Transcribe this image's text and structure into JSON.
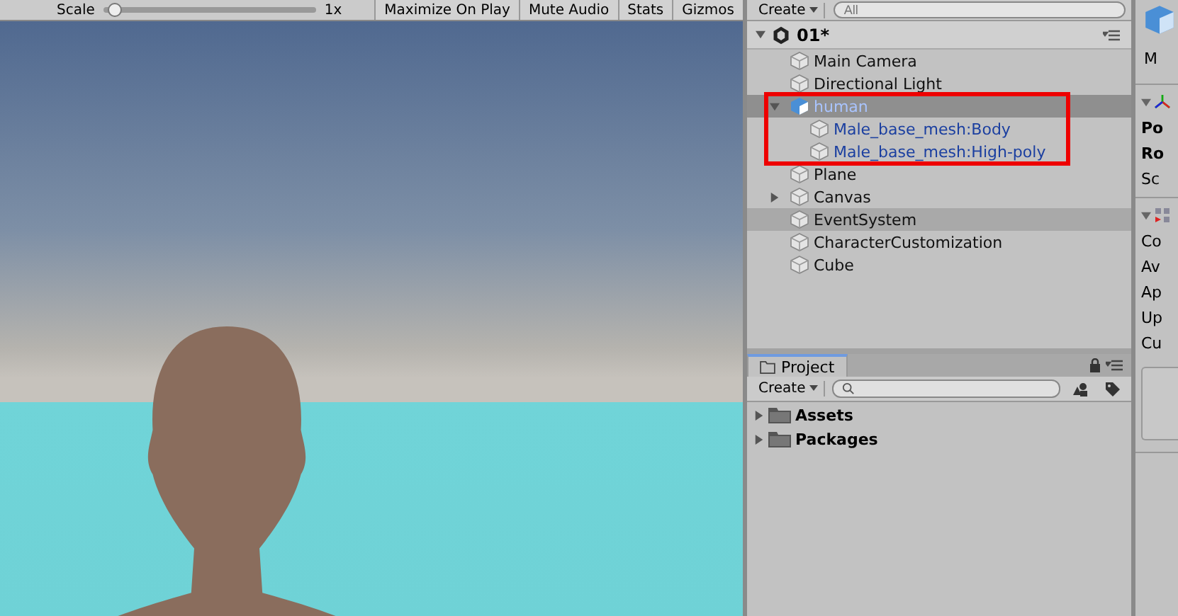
{
  "game_toolbar": {
    "scale_label": "Scale",
    "scale_slider": {
      "level": 0.02
    },
    "scale_value": "1x",
    "buttons": [
      {
        "label": "Maximize On Play",
        "on": false
      },
      {
        "label": "Mute Audio",
        "on": false
      },
      {
        "label": "Stats",
        "on": false
      },
      {
        "label": "Gizmos",
        "on": false
      }
    ]
  },
  "hierarchy": {
    "create_button": "Create",
    "search": {
      "placeholder": "All"
    },
    "scene": {
      "name": "01*",
      "expanded": true
    },
    "items": [
      {
        "name": "Main Camera",
        "kind": "object",
        "selected": false,
        "highlighted": false
      },
      {
        "name": "Directional Light",
        "kind": "object",
        "selected": false,
        "highlighted": false
      },
      {
        "name": "human",
        "kind": "prefab-root",
        "selected": true,
        "highlighted": false,
        "expanded": true,
        "children": [
          {
            "name": "Male_base_mesh:Body",
            "kind": "prefab",
            "selected": false,
            "highlighted": false
          },
          {
            "name": "Male_base_mesh:High-poly",
            "kind": "prefab",
            "selected": false,
            "highlighted": false
          }
        ]
      },
      {
        "name": "Plane",
        "kind": "object",
        "selected": false,
        "highlighted": false
      },
      {
        "name": "Canvas",
        "kind": "object",
        "selected": false,
        "highlighted": false,
        "expanded": false
      },
      {
        "name": "EventSystem",
        "kind": "object",
        "selected": false,
        "highlighted": true
      },
      {
        "name": "CharacterCustomization",
        "kind": "object",
        "selected": false,
        "highlighted": false
      },
      {
        "name": "Cube",
        "kind": "object",
        "selected": false,
        "highlighted": false
      }
    ]
  },
  "project": {
    "tab": {
      "label": "Project",
      "selected": true
    },
    "create_button": "Create",
    "items": [
      {
        "name": "Assets",
        "expanded": false
      },
      {
        "name": "Packages",
        "expanded": false
      }
    ]
  },
  "inspector": {
    "header_label": "M",
    "transform_fields": [
      "Po",
      "Ro",
      "Sc"
    ],
    "component_fields": [
      "Co",
      "Av",
      "Ap",
      "Up",
      "Cu"
    ]
  }
}
